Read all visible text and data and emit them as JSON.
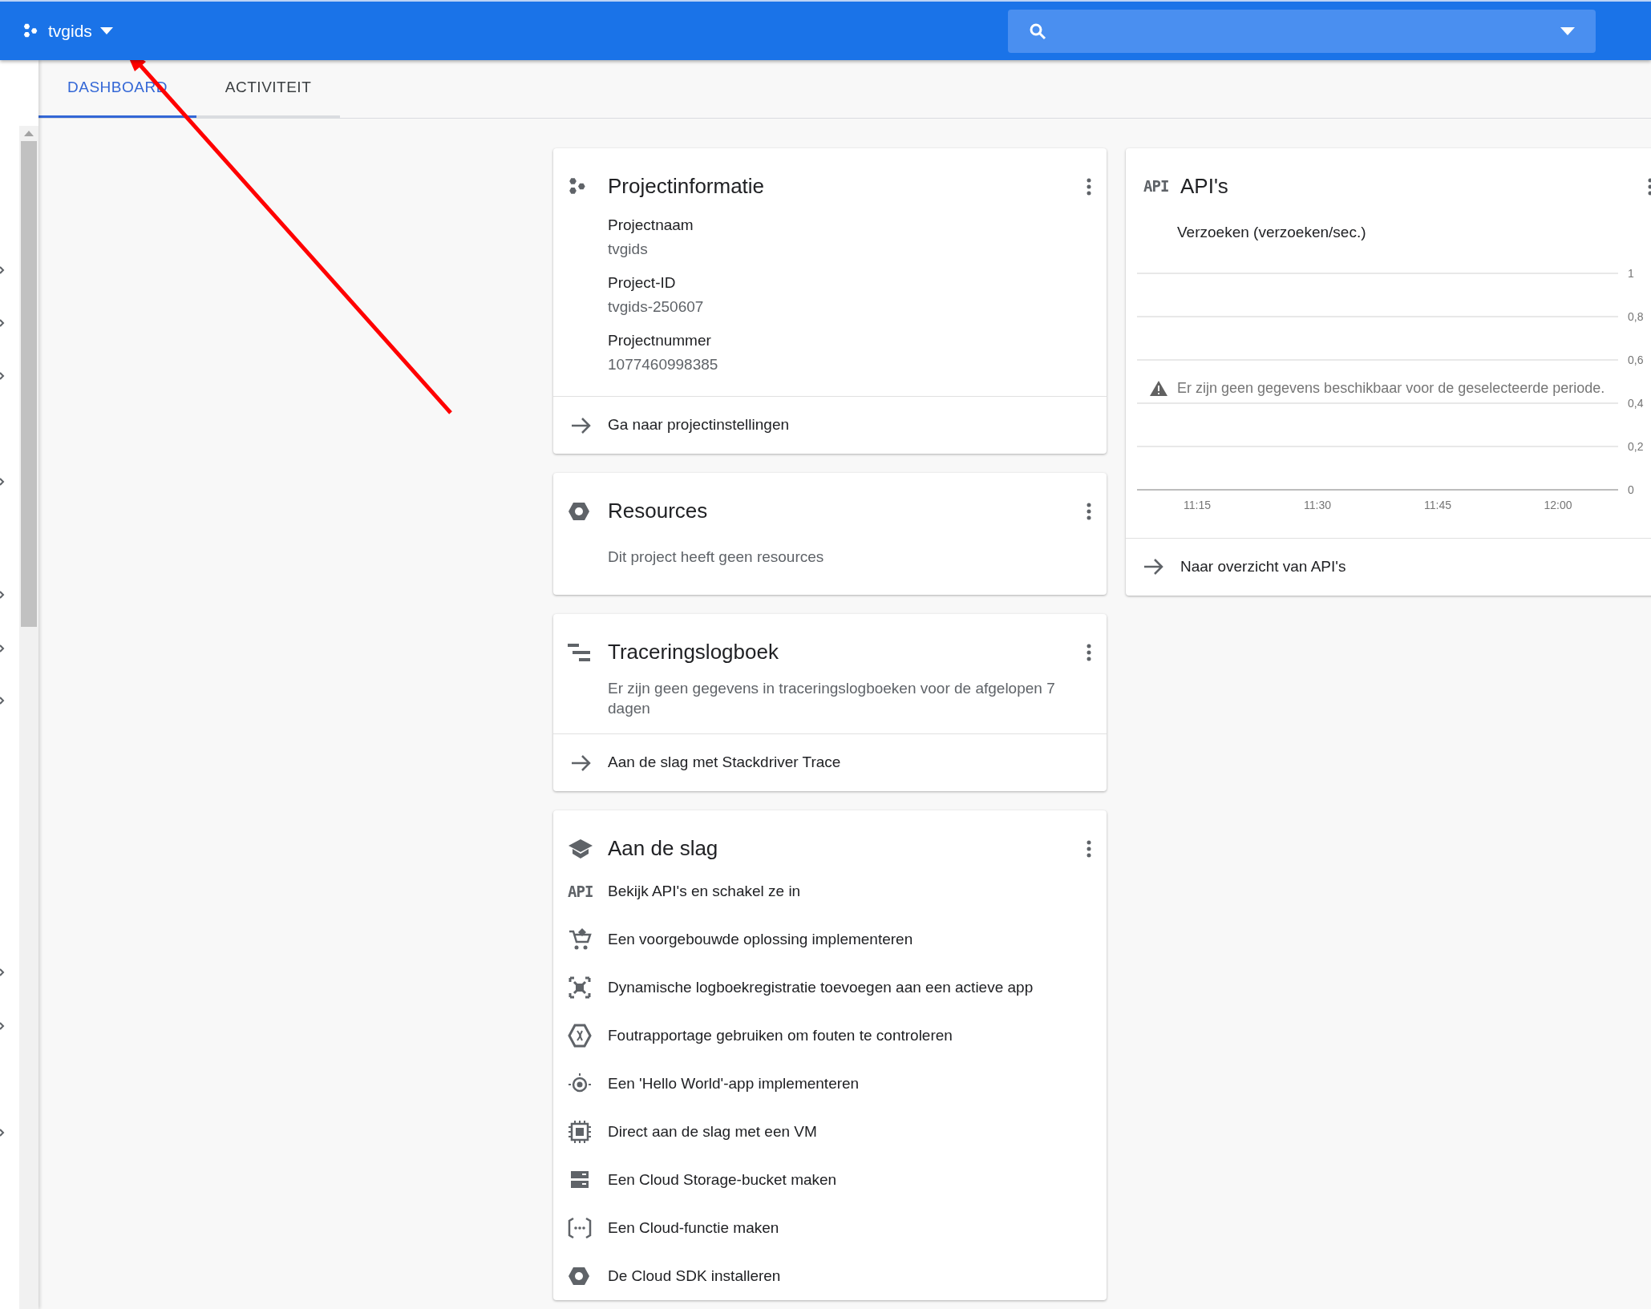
{
  "header": {
    "project": "tvgids"
  },
  "tabs": [
    {
      "label": "DASHBOARD",
      "selected": true
    },
    {
      "label": "ACTIVITEIT",
      "selected": false
    }
  ],
  "cards": [
    {
      "kind": "info",
      "title": "Projectinformatie",
      "fields": [
        {
          "label": "Projectnaam",
          "value": "tvgids"
        },
        {
          "label": "Project-ID",
          "value": "tvgids-250607"
        },
        {
          "label": "Projectnummer",
          "value": "1077460998385"
        }
      ],
      "link": "Ga naar projectinstellingen"
    },
    {
      "kind": "message",
      "title": "Resources",
      "message": "Dit project heeft geen resources"
    },
    {
      "kind": "message",
      "title": "Traceringslogboek",
      "message": "Er zijn geen gegevens in traceringslogboeken voor de afgelopen 7 dagen",
      "link": "Aan de slag met Stackdriver Trace"
    },
    {
      "kind": "list",
      "title": "Aan de slag",
      "items": [
        {
          "label": "Bekijk API's en schakel ze in",
          "icon_text": "API"
        },
        {
          "label": "Een voorgebouwde oplossing implementeren"
        },
        {
          "label": "Dynamische logboekregistratie toevoegen aan een actieve app"
        },
        {
          "label": "Foutrapportage gebruiken om fouten te controleren"
        },
        {
          "label": "Een 'Hello World'-app implementeren"
        },
        {
          "label": "Direct aan de slag met een VM"
        },
        {
          "label": "Een Cloud Storage-bucket maken"
        },
        {
          "label": "Een Cloud-functie maken"
        },
        {
          "label": "De Cloud SDK installeren"
        }
      ]
    }
  ],
  "api_card": {
    "icon_text": "API",
    "title": "API's",
    "chart_data": {
      "type": "line",
      "title": "Verzoeken (verzoeken/sec.)",
      "categories": [
        "11:15",
        "11:30",
        "11:45",
        "12:00"
      ],
      "ylim": [
        0,
        1
      ],
      "grid": true,
      "yticks": [
        {
          "value": 1,
          "label": "1"
        },
        {
          "value": 0.8,
          "label": "0,8"
        },
        {
          "value": 0.6,
          "label": "0,6"
        },
        {
          "value": 0.4,
          "label": "0,4"
        },
        {
          "value": 0.2,
          "label": "0,2"
        },
        {
          "value": 0,
          "label": "0"
        }
      ]
    },
    "notice": "Er zijn geen gegevens beschikbaar voor de geselecteerde periode.",
    "link": "Naar overzicht van API's"
  }
}
